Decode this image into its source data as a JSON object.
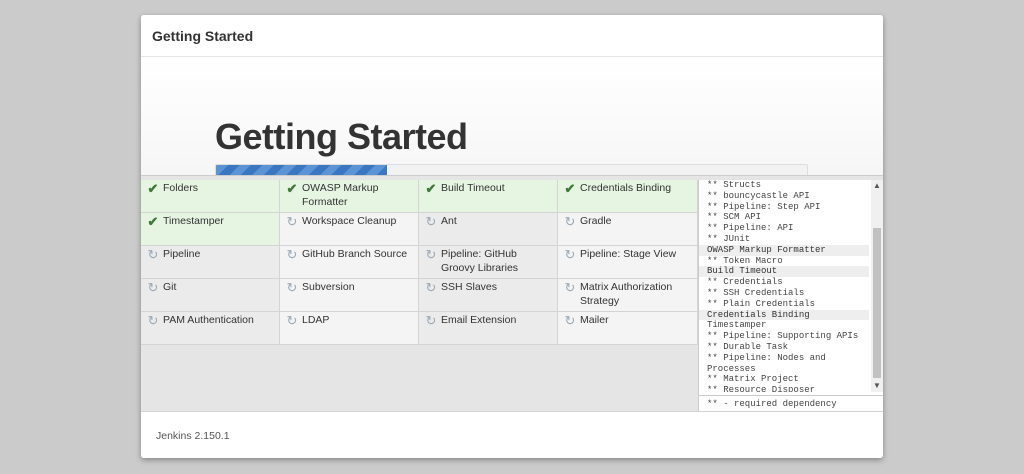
{
  "header": {
    "title": "Getting Started"
  },
  "hero": {
    "title": "Getting Started",
    "progress": 0.29
  },
  "plugins": [
    {
      "label": "Folders",
      "status": "done",
      "icon": "check-icon"
    },
    {
      "label": "OWASP Markup Formatter",
      "status": "done",
      "icon": "check-icon"
    },
    {
      "label": "Build Timeout",
      "status": "done",
      "icon": "check-icon"
    },
    {
      "label": "Credentials Binding",
      "status": "done",
      "icon": "check-icon"
    },
    {
      "label": "Timestamper",
      "status": "done",
      "icon": "check-icon"
    },
    {
      "label": "Workspace Cleanup",
      "status": "pending",
      "icon": "refresh-icon"
    },
    {
      "label": "Ant",
      "status": "pending",
      "icon": "refresh-icon"
    },
    {
      "label": "Gradle",
      "status": "pending",
      "icon": "refresh-icon"
    },
    {
      "label": "Pipeline",
      "status": "pending",
      "icon": "refresh-icon"
    },
    {
      "label": "GitHub Branch Source",
      "status": "pending",
      "icon": "refresh-icon"
    },
    {
      "label": "Pipeline: GitHub Groovy Libraries",
      "status": "pending",
      "icon": "refresh-icon"
    },
    {
      "label": "Pipeline: Stage View",
      "status": "pending",
      "icon": "refresh-icon"
    },
    {
      "label": "Git",
      "status": "pending",
      "icon": "refresh-icon"
    },
    {
      "label": "Subversion",
      "status": "pending",
      "icon": "refresh-icon"
    },
    {
      "label": "SSH Slaves",
      "status": "pending",
      "icon": "refresh-icon"
    },
    {
      "label": "Matrix Authorization Strategy",
      "status": "pending",
      "icon": "refresh-icon"
    },
    {
      "label": "PAM Authentication",
      "status": "pending",
      "icon": "refresh-icon"
    },
    {
      "label": "LDAP",
      "status": "pending",
      "icon": "refresh-icon"
    },
    {
      "label": "Email Extension",
      "status": "pending",
      "icon": "refresh-icon"
    },
    {
      "label": "Mailer",
      "status": "pending",
      "icon": "refresh-icon"
    }
  ],
  "log": {
    "lines": [
      {
        "text": "** Structs",
        "type": "dep"
      },
      {
        "text": "** bouncycastle API",
        "type": "dep"
      },
      {
        "text": "** Pipeline: Step API",
        "type": "dep"
      },
      {
        "text": "** SCM API",
        "type": "dep"
      },
      {
        "text": "** Pipeline: API",
        "type": "dep"
      },
      {
        "text": "** JUnit",
        "type": "dep"
      },
      {
        "text": "OWASP Markup Formatter",
        "type": "hdr"
      },
      {
        "text": "** Token Macro",
        "type": "dep"
      },
      {
        "text": "Build Timeout",
        "type": "hdr"
      },
      {
        "text": "** Credentials",
        "type": "dep"
      },
      {
        "text": "** SSH Credentials",
        "type": "dep"
      },
      {
        "text": "** Plain Credentials",
        "type": "dep"
      },
      {
        "text": "Credentials Binding",
        "type": "hdr"
      },
      {
        "text": "Timestamper",
        "type": "plain"
      },
      {
        "text": "** Pipeline: Supporting APIs",
        "type": "dep"
      },
      {
        "text": "** Durable Task",
        "type": "dep"
      },
      {
        "text": "** Pipeline: Nodes and Processes",
        "type": "wrap"
      },
      {
        "text": "** Matrix Project",
        "type": "dep"
      },
      {
        "text": "** Resource Disposer",
        "type": "dep"
      }
    ],
    "footer": "** - required dependency"
  },
  "footer": {
    "version": "Jenkins 2.150.1"
  },
  "colors": {
    "accent": "#3a77c0",
    "done_bg": "#e6f4e2",
    "check": "#3f7a38"
  }
}
